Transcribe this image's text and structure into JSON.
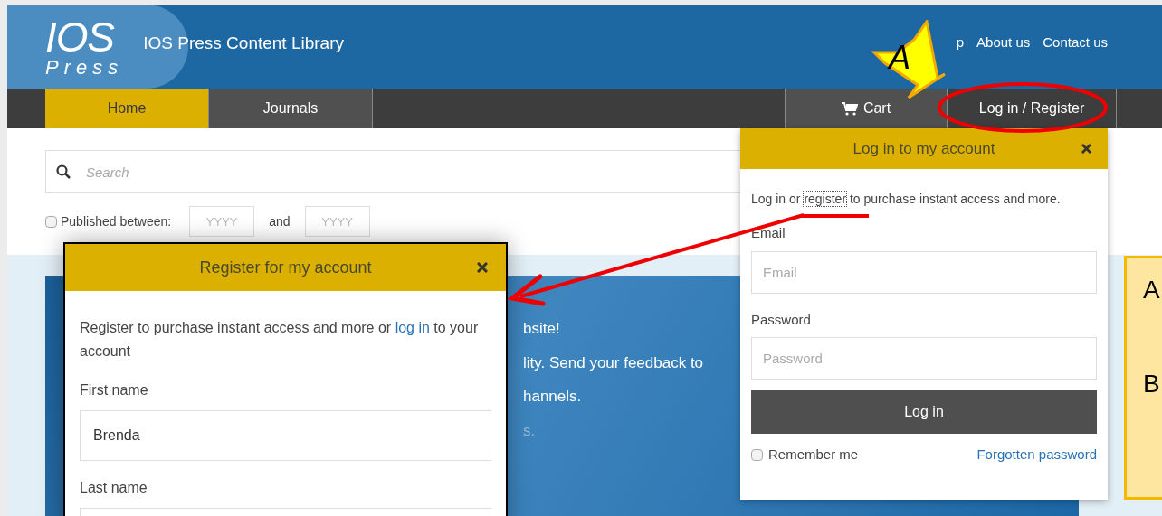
{
  "header": {
    "logo_top": "IOS",
    "logo_bottom": "Press",
    "site_title": "IOS Press Content Library",
    "links": [
      "p",
      "About us",
      "Contact us"
    ]
  },
  "nav": {
    "tabs": [
      {
        "label": "Home",
        "selected": true
      },
      {
        "label": "Journals",
        "selected": false
      }
    ],
    "right": [
      {
        "kind": "cart",
        "label": "Cart"
      },
      {
        "kind": "account",
        "label": "Log in / Register"
      }
    ]
  },
  "search": {
    "placeholder": "Search"
  },
  "date_filter": {
    "checked": false,
    "label": "Published between:",
    "from_placeholder": "YYYY",
    "joiner": "and",
    "to_placeholder": "YYYY"
  },
  "banner": {
    "lines": [
      "bsite!",
      "lity. Send your feedback to",
      "hannels.",
      "s."
    ]
  },
  "register_dialog": {
    "title": "Register for my account",
    "intro": "Register to purchase instant access and more or",
    "link": "log in",
    "outro": "to your account",
    "fields": [
      {
        "label": "First name",
        "value": "Brenda"
      },
      {
        "label": "Last name"
      }
    ]
  },
  "login_dialog": {
    "title": "Log in to my account",
    "intro_start": "Log in or",
    "link": "register",
    "intro_end": "to purchase instant access and more.",
    "fields": [
      {
        "label": "Email",
        "placeholder": "Email"
      },
      {
        "label": "Password",
        "placeholder": "Password"
      }
    ],
    "submit": "Log in",
    "remember": {
      "label": "Remember me",
      "checked": false
    },
    "forgot": "Forgotten password"
  },
  "annotations": {
    "star_label": "A",
    "note_lines": [
      "A",
      "B"
    ]
  }
}
